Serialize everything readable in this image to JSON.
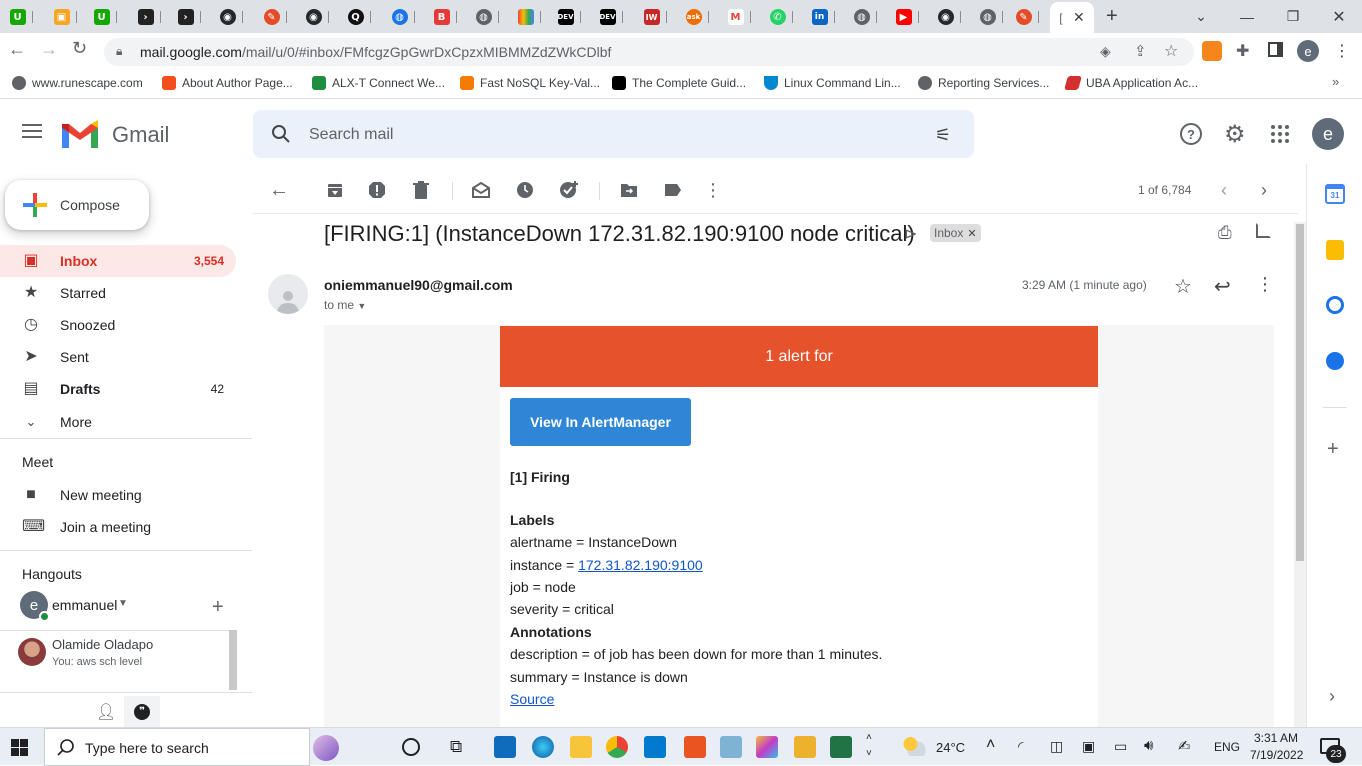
{
  "browser": {
    "active_tab_title": "[",
    "tab_favicons": [
      "upwork",
      "box",
      "upwork",
      "terminal",
      "terminal",
      "github",
      "pen",
      "github",
      "q",
      "globe",
      "slides",
      "globe",
      "photos",
      "dev",
      "dev",
      "iw",
      "ask",
      "gmail",
      "whatsapp",
      "linkedin",
      "globe",
      "youtube",
      "github",
      "globe",
      "pen"
    ],
    "url_host": "mail.google.com",
    "url_path": "/mail/u/0/#inbox/FMfcgzGpGwrDxCpzxMIBMMZdZWkCDlbf",
    "profile_initial": "e",
    "bookmarks": [
      {
        "label": "www.runescape.com",
        "color": "#5f6368"
      },
      {
        "label": "About Author Page...",
        "color": "#f24e1e"
      },
      {
        "label": "ALX-T Connect We...",
        "color": "#1e8e3e"
      },
      {
        "label": "Fast NoSQL Key-Val...",
        "color": "#f57c00"
      },
      {
        "label": "The Complete Guid...",
        "color": "#000000"
      },
      {
        "label": "Linux Command Lin...",
        "color": "#0288d1"
      },
      {
        "label": "Reporting Services...",
        "color": "#5f6368"
      },
      {
        "label": "UBA Application Ac...",
        "color": "#d32f2f"
      }
    ]
  },
  "gmail": {
    "app_name": "Gmail",
    "search_placeholder": "Search mail",
    "account_initial": "e",
    "compose_label": "Compose",
    "nav": [
      {
        "label": "Inbox",
        "count": "3,554",
        "icon": "inbox-icon"
      },
      {
        "label": "Starred",
        "count": "",
        "icon": "star-icon"
      },
      {
        "label": "Snoozed",
        "count": "",
        "icon": "clock-icon"
      },
      {
        "label": "Sent",
        "count": "",
        "icon": "send-icon"
      },
      {
        "label": "Drafts",
        "count": "42",
        "icon": "draft-icon"
      },
      {
        "label": "More",
        "count": "",
        "icon": "chevron-down-icon"
      }
    ],
    "meet": {
      "heading": "Meet",
      "new_meeting": "New meeting",
      "join_meeting": "Join a meeting"
    },
    "hangouts": {
      "heading": "Hangouts",
      "user_name": "emmanuel",
      "user_initial": "e",
      "contact_name": "Olamide Oladapo",
      "contact_snippet": "You: aws sch level"
    },
    "pagination": "1 of 6,784",
    "message": {
      "subject": "[FIRING:1] (InstanceDown 172.31.82.190:9100 node critical)",
      "label": "Inbox",
      "sender": "oniemmanuel90@gmail.com",
      "recipient": "to me",
      "time": "3:29 AM (1 minute ago)"
    },
    "alert_email": {
      "banner": "1 alert for",
      "button": "View In AlertManager",
      "firing": "[1] Firing",
      "labels_heading": "Labels",
      "alertname": "alertname = InstanceDown",
      "instance_prefix": "instance = ",
      "instance_link": "172.31.82.190:9100",
      "job": "job = node",
      "severity": "severity = critical",
      "annotations_heading": "Annotations",
      "description": "description = of job has been down for more than 1 minutes.",
      "summary": "summary = Instance is down",
      "source": "Source"
    }
  },
  "taskbar": {
    "search_placeholder": "Type here to search",
    "weather": "24°C",
    "language": "ENG",
    "time": "3:31 AM",
    "date": "7/19/2022",
    "notifications": "23"
  }
}
